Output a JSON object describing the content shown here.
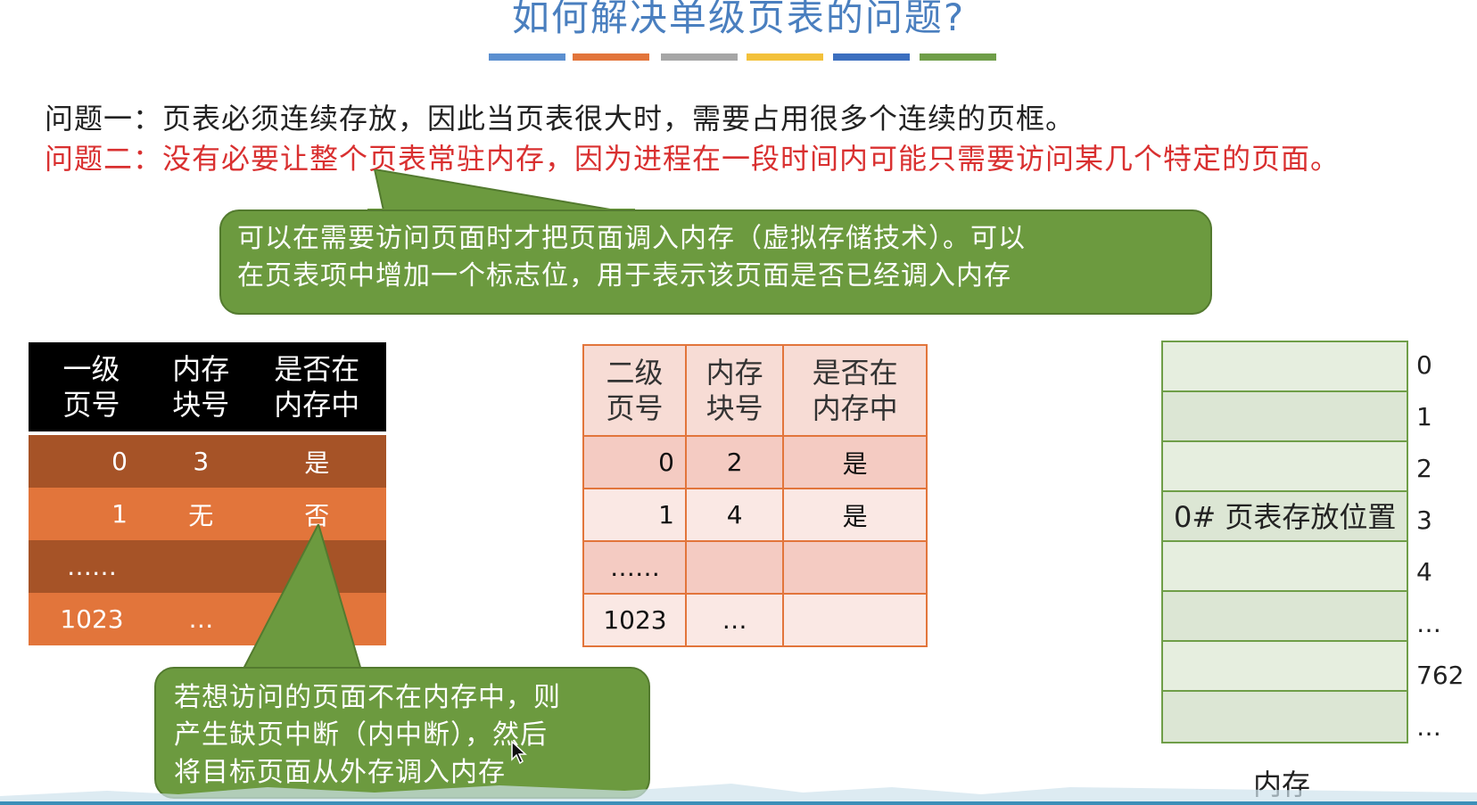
{
  "slide": {
    "title": "如何解决单级页表的问题?",
    "title_colors": [
      "#5b8fd0",
      "#e2753b",
      "#a6a6a6",
      "#f3c13a",
      "#3c6fbf",
      "#6f9e48"
    ]
  },
  "problems": {
    "line1": "问题一：页表必须连续存放，因此当页表很大时，需要占用很多个连续的页框。",
    "line2": "问题二：没有必要让整个页表常驻内存，因为进程在一段时间内可能只需要访问某几个特定的页面。"
  },
  "callout_top": {
    "line1": "可以在需要访问页面时才把页面调入内存（虚拟存储技术）。可以",
    "line2": "在页表项中增加一个标志位，用于表示该页面是否已经调入内存"
  },
  "callout_bottom": {
    "line1": "若想访问的页面不在内存中，则",
    "line2": "产生缺页中断（内中断），然后",
    "line3": "将目标页面从外存调入内存"
  },
  "table1": {
    "headers": [
      {
        "l1": "一级",
        "l2": "页号"
      },
      {
        "l1": "内存",
        "l2": "块号"
      },
      {
        "l1": "是否在",
        "l2": "内存中"
      }
    ],
    "rows": [
      [
        "0",
        "3",
        "是"
      ],
      [
        "1",
        "无",
        "否"
      ],
      [
        "……",
        "",
        ""
      ],
      [
        "1023",
        "…",
        ""
      ]
    ]
  },
  "table2": {
    "headers": [
      {
        "l1": "二级",
        "l2": "页号"
      },
      {
        "l1": "内存",
        "l2": "块号"
      },
      {
        "l1": "是否在",
        "l2": "内存中"
      }
    ],
    "rows": [
      [
        "0",
        "2",
        "是"
      ],
      [
        "1",
        "4",
        "是"
      ],
      [
        "……",
        "",
        ""
      ],
      [
        "1023",
        "…",
        ""
      ]
    ]
  },
  "memory": {
    "label": "内存",
    "cells": [
      "",
      "",
      "",
      "0# 页表存放位置",
      "",
      "",
      "",
      ""
    ],
    "indices": [
      "0",
      "1",
      "2",
      "3",
      "4",
      "…",
      "762",
      "…"
    ]
  }
}
